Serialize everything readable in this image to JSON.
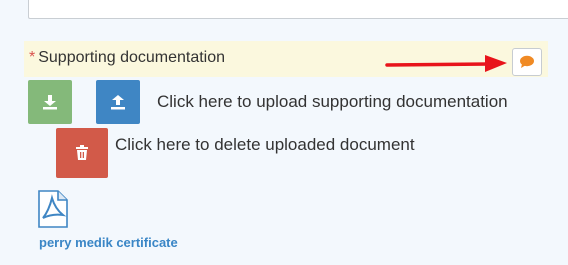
{
  "form": {
    "field_label": "Supporting documentation",
    "required_marker": "*",
    "upload_label": "Click here to upload supporting documentation",
    "delete_label": "Click here to delete uploaded document",
    "uploaded_file_name": "perry medik certificate"
  },
  "icons": {
    "comment": "comment-icon",
    "download": "download-icon",
    "upload": "upload-icon",
    "delete": "trash-icon",
    "file": "pdf-file-icon",
    "annotation": "red-arrow"
  },
  "colors": {
    "required": "#d9534f",
    "download_button": "#84b97a",
    "upload_button": "#3f86c4",
    "delete_button": "#d25a49",
    "comment_icon": "#f08a24",
    "link": "#3a86c6",
    "annotation_arrow": "#e8141b",
    "field_highlight": "#fbf8de"
  }
}
